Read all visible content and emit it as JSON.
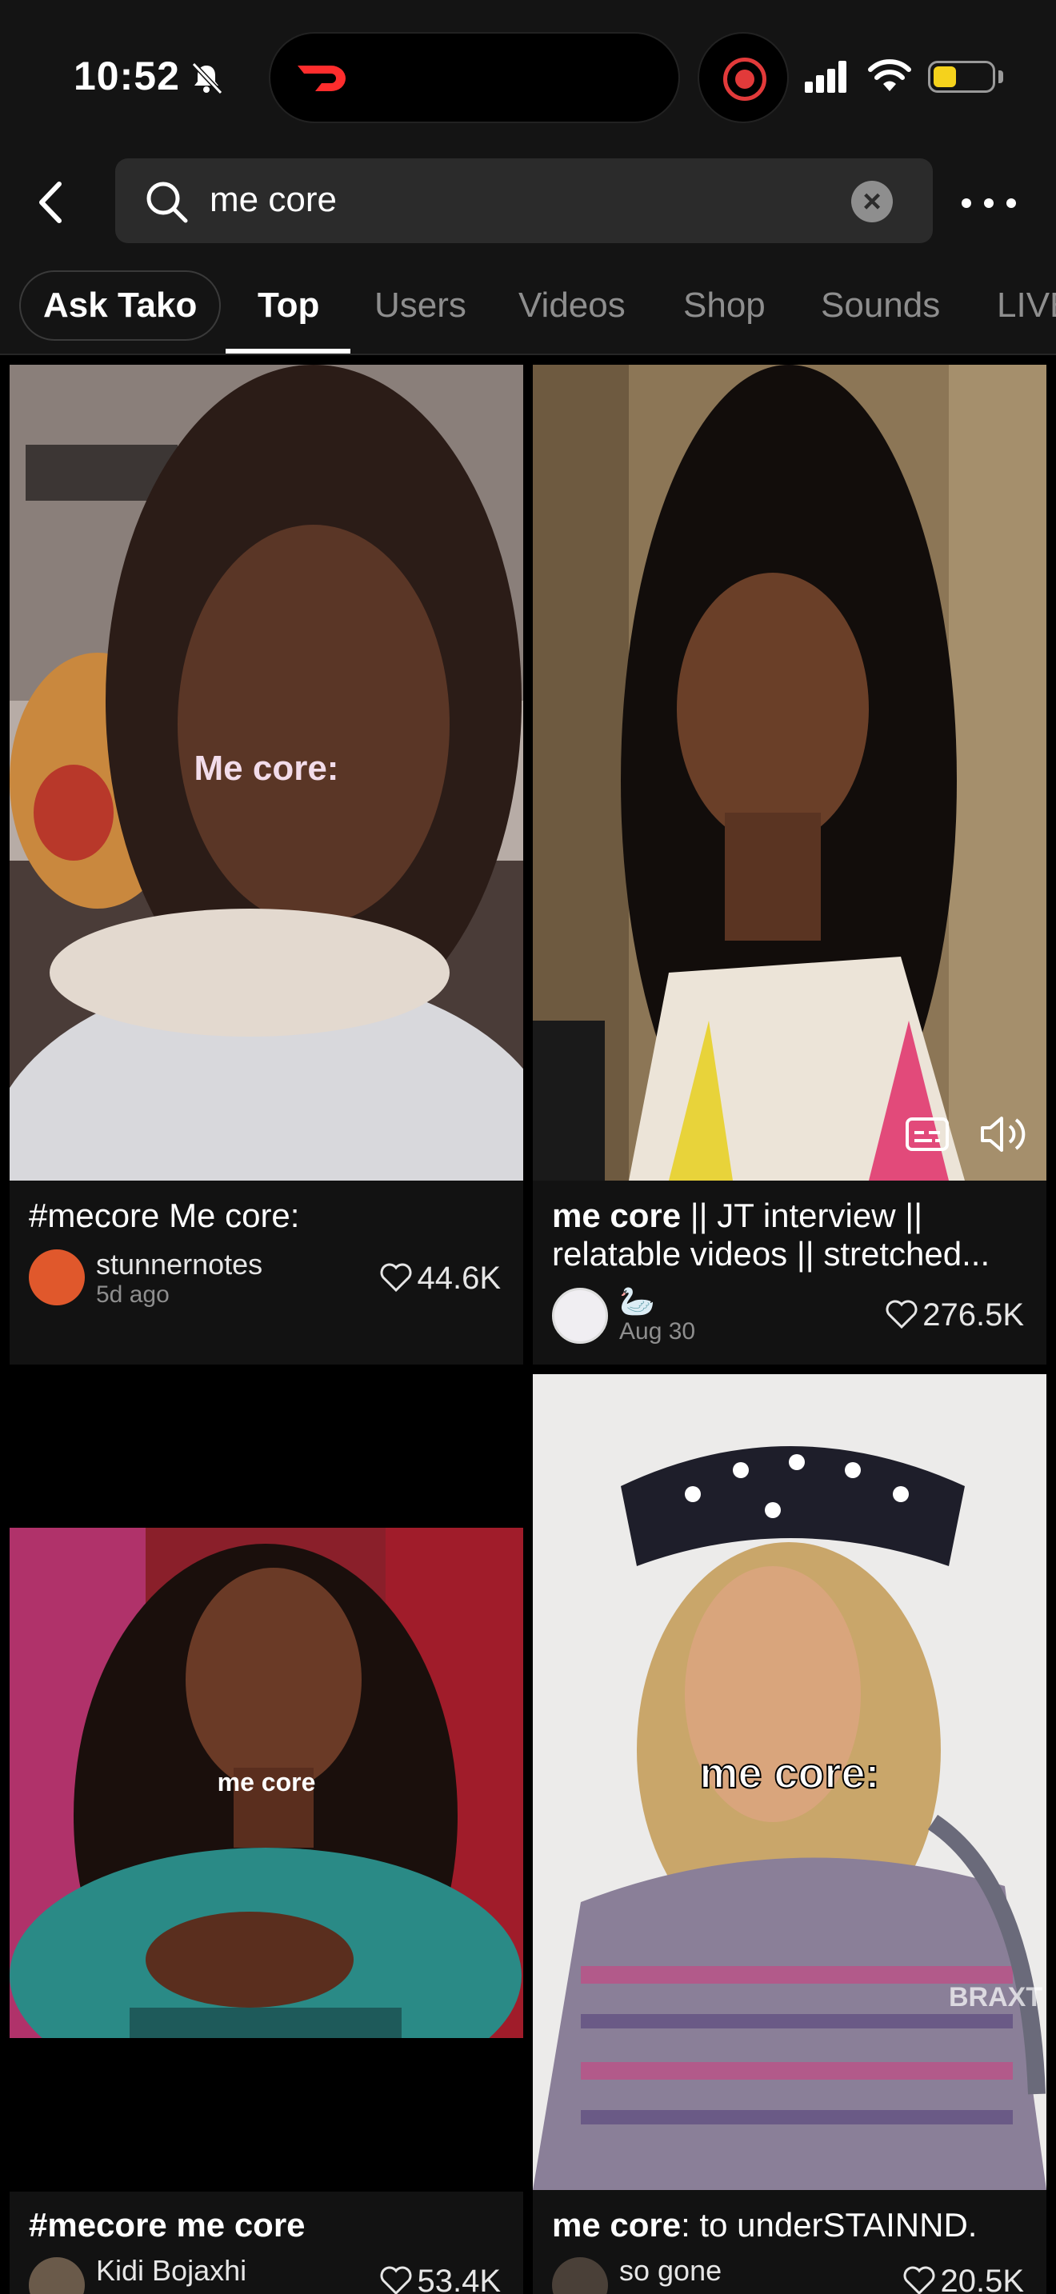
{
  "status": {
    "time": "10:52"
  },
  "search": {
    "query": "me core",
    "clear_label": "×"
  },
  "tabs": {
    "ask": "Ask Tako",
    "items": [
      "Top",
      "Users",
      "Videos",
      "Shop",
      "Sounds",
      "LIVE"
    ]
  },
  "cards": [
    {
      "overlay": "Me core:",
      "title_bold": "",
      "title": "#mecore Me core:",
      "author": "stunnernotes",
      "date": "5d ago",
      "likes": "44.6K"
    },
    {
      "overlay": "",
      "title_bold": "me core",
      "title": " || JT interview || relatable videos || stretched...",
      "author": "🦢",
      "date": "Aug 30",
      "likes": "276.5K"
    },
    {
      "overlay": "me core",
      "title_bold": "#mecore me core",
      "title": "",
      "author": "Kidi Bojaxhi",
      "date": "",
      "likes": "53.4K"
    },
    {
      "overlay": "me core:",
      "watermark": "BRAXT",
      "title_bold": "me core",
      "title": ": to underSTAINND.",
      "author": "so gone",
      "date": "",
      "likes": "20.5K"
    }
  ],
  "colors": {
    "background": "#000000",
    "surface": "#121212",
    "header": "#141414",
    "record": "#e23a3a",
    "battery": "#f5d21c"
  }
}
